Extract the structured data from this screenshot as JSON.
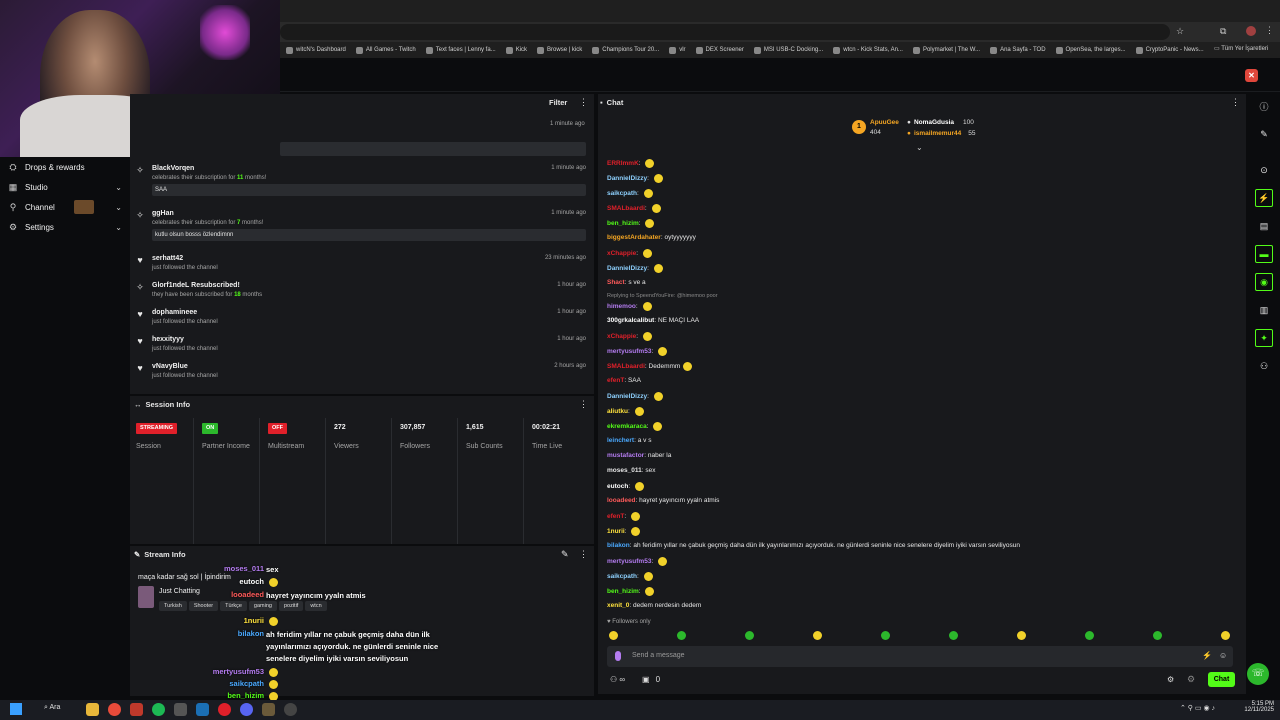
{
  "browser": {
    "bookmarks": [
      {
        "label": "witcN's Dashboard",
        "icon": "kick-icon"
      },
      {
        "label": "All Games - Twitch",
        "icon": "twitch-icon"
      },
      {
        "label": "Text faces | Lenny fa...",
        "icon": "lenny-icon"
      },
      {
        "label": "Kick",
        "icon": "kick-icon"
      },
      {
        "label": "Browse | kick",
        "icon": "kick-icon"
      },
      {
        "label": "Champions Tour 20...",
        "icon": "vlr-icon"
      },
      {
        "label": "vlr",
        "icon": "vlr-icon"
      },
      {
        "label": "DEX Screener",
        "icon": "dex-icon"
      },
      {
        "label": "MSI USB-C Docking...",
        "icon": "msi-icon"
      },
      {
        "label": "wtcn - Kick Stats, An...",
        "icon": "stats-icon"
      },
      {
        "label": "Polymarket | The W...",
        "icon": "polymarket-icon"
      },
      {
        "label": "Ana Sayfa - TOD",
        "icon": "tod-icon"
      },
      {
        "label": "OpenSea, the larges...",
        "icon": "opensea-icon"
      },
      {
        "label": "CryptoPanic - News...",
        "icon": "cryptopanic-icon"
      }
    ],
    "all_bookmarks": "Tüm Yer İşaretleri"
  },
  "sidebar": {
    "items": [
      {
        "label": "Drops & rewards",
        "icon": "gift-icon"
      },
      {
        "label": "Studio",
        "icon": "studio-icon"
      },
      {
        "label": "Channel",
        "icon": "channel-icon"
      },
      {
        "label": "Settings",
        "icon": "gear-icon"
      }
    ]
  },
  "activity": {
    "filter_label": "Filter",
    "top_time": "1 minute ago",
    "items": [
      {
        "name": "BlackVorqen",
        "prefix": "celebrates their subscription for ",
        "count": "11",
        "suffix": " months!",
        "time": "1 minute ago",
        "message": "SAA",
        "icon": "star-icon"
      },
      {
        "name": "ggHan",
        "prefix": "celebrates their subscription for ",
        "count": "7",
        "suffix": " months!",
        "time": "1 minute ago",
        "message": "kutlu olsun bosss özlendimnn",
        "icon": "star-icon"
      },
      {
        "name": "serhatt42",
        "sub": "just followed the channel",
        "time": "23 minutes ago",
        "icon": "heart-icon"
      },
      {
        "name": "Glorf1ndeL Resubscribed!",
        "prefix": "they have been subscribed for ",
        "count": "18",
        "suffix": " months",
        "time": "1 hour ago",
        "icon": "star-icon"
      },
      {
        "name": "dophamineee",
        "sub": "just followed the channel",
        "time": "1 hour ago",
        "icon": "heart-icon"
      },
      {
        "name": "hexxityyy",
        "sub": "just followed the channel",
        "time": "1 hour ago",
        "icon": "heart-icon"
      },
      {
        "name": "vNavyBlue",
        "sub": "just followed the channel",
        "time": "2 hours ago",
        "icon": "heart-icon"
      }
    ]
  },
  "session": {
    "title": "Session Info",
    "stats": [
      {
        "badge": "STREAMING",
        "badge_color": "#e0202a",
        "label": "Session"
      },
      {
        "badge": "ON",
        "badge_color": "#2cb82c",
        "label": "Partner Income"
      },
      {
        "badge": "OFF",
        "badge_color": "#e0202a",
        "label": "Multistream"
      },
      {
        "value": "272",
        "label": "Viewers"
      },
      {
        "value": "307,857",
        "label": "Followers"
      },
      {
        "value": "1,615",
        "label": "Sub Counts"
      },
      {
        "value": "00:02:21",
        "label": "Time Live"
      }
    ]
  },
  "stream_info": {
    "title": "Stream Info",
    "stream_title": "maça kadar sağ sol | İpindirim",
    "category": "Just Chatting",
    "tags": [
      "Turkish",
      "Shooter",
      "Türkçe",
      "gaming",
      "pozitif",
      "wtcn"
    ]
  },
  "overlay_chat": [
    {
      "user": "moses_011",
      "text": "sex",
      "color": "#b47cf0"
    },
    {
      "user": "eutoch",
      "text": "",
      "color": "#ffffff"
    },
    {
      "user": "looadeed",
      "text": "hayret yayıncım yyaln atmis",
      "color": "#ff5a5a"
    },
    {
      "user": "1nurii",
      "text": "",
      "color": "#ffe23d"
    },
    {
      "user": "bilakon",
      "text": "ah feridim yıllar ne çabuk geçmiş daha dün ilk yayınlarımızı açıyorduk. ne günlerdi seninle nice senelere diyelim iyiki varsın seviliyosun",
      "color": "#4aa9ff"
    },
    {
      "user": "mertyusufm53",
      "text": "",
      "color": "#b47cf0"
    },
    {
      "user": "saikcpath",
      "text": "",
      "color": "#4aa9ff"
    },
    {
      "user": "ben_hizim",
      "text": "",
      "color": "#53fc18"
    }
  ],
  "chat": {
    "title": "Chat",
    "top_gifters": [
      {
        "name": "ApuuGee",
        "value": "404",
        "color": "#f5a623"
      },
      {
        "name": "NomaGdusia",
        "value": "100",
        "color": "#ffffff"
      },
      {
        "name": "ismailmemur44",
        "value": "55",
        "color": "#f5a623"
      }
    ],
    "messages": [
      {
        "user": "ERRImmK",
        "text": "",
        "color": "#e0202a",
        "emote": true
      },
      {
        "user": "DannielDizzy",
        "text": "",
        "color": "#8ed1ff",
        "emote": true
      },
      {
        "user": "saikcpath",
        "text": "",
        "color": "#8ed1ff",
        "emote": true
      },
      {
        "user": "SMALbaardi",
        "text": "",
        "color": "#e0202a",
        "emote": true
      },
      {
        "user": "ben_hizim",
        "text": "",
        "color": "#53fc18",
        "emote": true
      },
      {
        "user": "biggestArdahater",
        "text": "oytyyyyyyy",
        "color": "#f5a623",
        "emote": false
      },
      {
        "user": "xChappie",
        "text": "",
        "color": "#e0202a",
        "emote": true
      },
      {
        "user": "DannielDizzy",
        "text": "",
        "color": "#8ed1ff",
        "emote": true
      },
      {
        "user": "Shact",
        "text": "s ve a",
        "color": "#ff5a5a",
        "emote": false
      },
      {
        "user": "himemoo",
        "text": "",
        "color": "#b47cf0",
        "emote": true,
        "reply": "Replying to SpeendYouFire: @himemoo poor"
      },
      {
        "user": "300grkalcalibut",
        "text": "NE MAÇI LAA",
        "color": "#ffffff",
        "emote": false
      },
      {
        "user": "xChappie",
        "text": "",
        "color": "#e0202a",
        "emote": true
      },
      {
        "user": "mertyusufm53",
        "text": "",
        "color": "#b47cf0",
        "emote": true
      },
      {
        "user": "SMALbaardi",
        "text": "Dedemmm",
        "color": "#e0202a",
        "emote": true
      },
      {
        "user": "efenT",
        "text": "SAA",
        "color": "#e0202a",
        "emote": false
      },
      {
        "user": "DannielDizzy",
        "text": "",
        "color": "#8ed1ff",
        "emote": true
      },
      {
        "user": "aliutku",
        "text": "",
        "color": "#ffe23d",
        "emote": true
      },
      {
        "user": "ekremkaraca",
        "text": "",
        "color": "#53fc18",
        "emote": true
      },
      {
        "user": "leinchert",
        "text": "a v s",
        "color": "#4aa9ff",
        "emote": false
      },
      {
        "user": "mustafactor",
        "text": "naber la",
        "color": "#b47cf0",
        "emote": false
      },
      {
        "user": "moses_011",
        "text": "sex",
        "color": "#e8e8e8",
        "emote": false
      },
      {
        "user": "eutoch",
        "text": "",
        "color": "#ffffff",
        "emote": true
      },
      {
        "user": "looadeed",
        "text": "hayret yayıncım yyaln atmis",
        "color": "#ff5a5a",
        "emote": false
      },
      {
        "user": "efenT",
        "text": "",
        "color": "#e0202a",
        "emote": true
      },
      {
        "user": "1nurii",
        "text": "",
        "color": "#ffe23d",
        "emote": true
      },
      {
        "user": "bilakon",
        "text": "ah feridim yıllar ne çabuk geçmiş daha dün ilk yayınlarımızı açıyorduk. ne günlerdi seninle nice senelere diyelim iyiki varsın seviliyosun",
        "color": "#4aa9ff",
        "emote": false
      },
      {
        "user": "mertyusufm53",
        "text": "",
        "color": "#b47cf0",
        "emote": true
      },
      {
        "user": "saikcpath",
        "text": "",
        "color": "#8ed1ff",
        "emote": true
      },
      {
        "user": "ben_hizim",
        "text": "",
        "color": "#53fc18",
        "emote": true
      },
      {
        "user": "xenit_0",
        "text": "dedem nerdesin dedem",
        "color": "#ffe23d",
        "emote": false
      }
    ],
    "followers_only": "Followers only",
    "input_placeholder": "Send a message",
    "points": "0",
    "send_label": "Chat"
  },
  "taskbar": {
    "search": "Ara",
    "time": "5:15 PM",
    "date": "12/11/2025"
  },
  "colors": {
    "accent": "#53fc18",
    "panel": "#18191c",
    "bg": "#0b0c0e"
  }
}
